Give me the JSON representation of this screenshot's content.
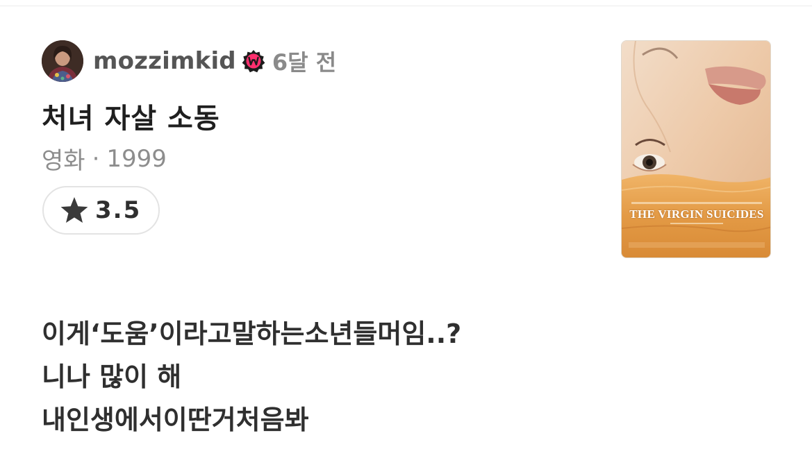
{
  "review": {
    "username": "mozzimkid",
    "badge_icon": "watcha-w-badge-icon",
    "badge_color": "#ff2f6e",
    "time_ago": "6달 전",
    "movie_title": "처녀 자살 소동",
    "category": "영화",
    "separator": "·",
    "year": "1999",
    "rating": "3.5",
    "rating_icon": "star-icon",
    "poster_title": "THE VIRGIN SUICIDES",
    "body_lines": [
      "이게‘도움’이라고말하는소년들머임..?",
      "니나 많이 해",
      "내인생에서이딴거처음봐"
    ]
  }
}
